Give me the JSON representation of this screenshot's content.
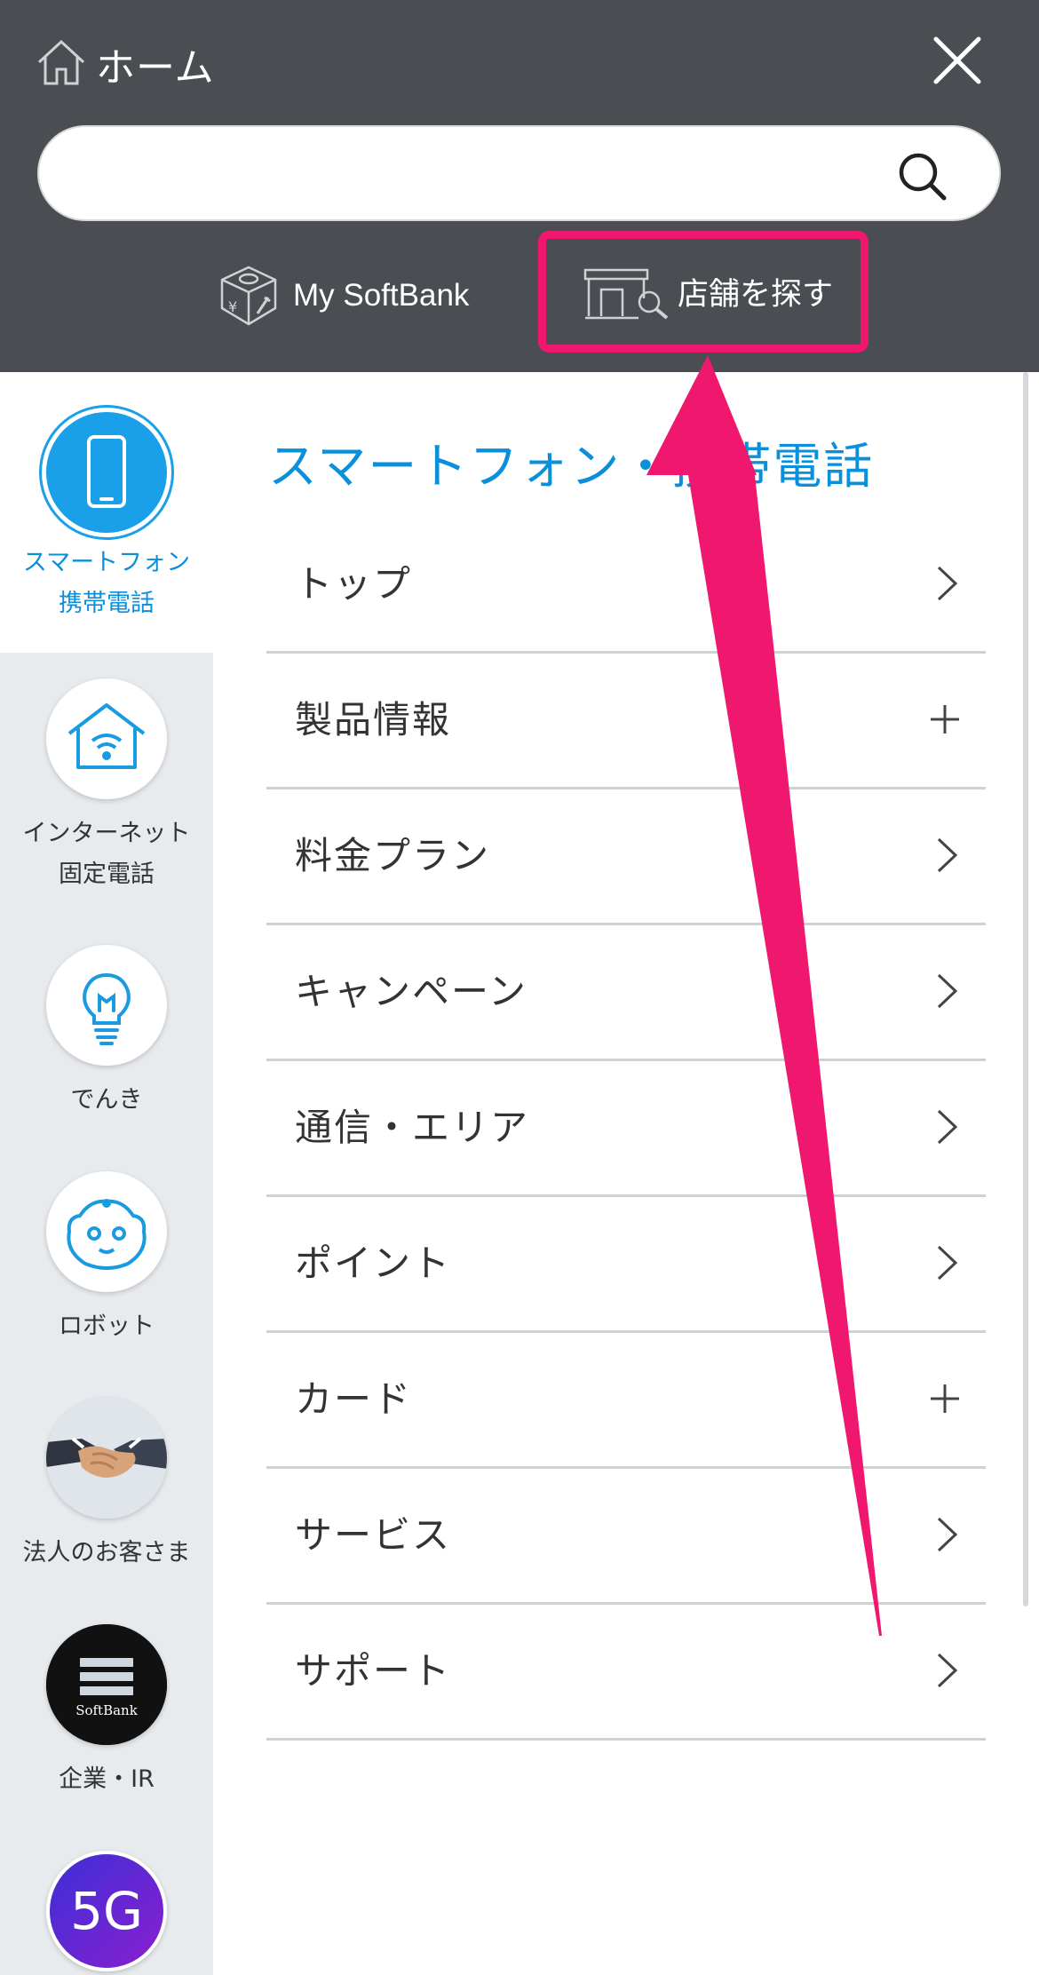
{
  "header": {
    "home_label": "ホーム",
    "search_placeholder": "",
    "mysoftbank_label": "My SoftBank",
    "store_label": "店舗を探す",
    "background": "#4a4d52"
  },
  "rail": {
    "items": [
      {
        "label_line1": "スマートフォン",
        "label_line2": "携帯電話",
        "icon": "smartphone-icon",
        "active": true
      },
      {
        "label_line1": "インターネット",
        "label_line2": "固定電話",
        "icon": "house-wifi-icon"
      },
      {
        "label_line1": "でんき",
        "label_line2": "",
        "icon": "lightbulb-icon"
      },
      {
        "label_line1": "ロボット",
        "label_line2": "",
        "icon": "robot-face-icon"
      },
      {
        "label_line1": "法人のお客さま",
        "label_line2": "",
        "icon": "handshake-icon"
      },
      {
        "label_line1": "企業・IR",
        "label_line2": "",
        "icon": "softbank-logo-icon",
        "logo_text": "SoftBank"
      },
      {
        "label_line1": "",
        "label_line2": "",
        "icon": "5g-icon",
        "logo_text": "5G"
      }
    ]
  },
  "main": {
    "title": "スマートフォン・携帯電話",
    "menu": [
      {
        "label": "トップ",
        "icon": "chevron-right-icon"
      },
      {
        "label": "製品情報",
        "icon": "plus-icon"
      },
      {
        "label": "料金プラン",
        "icon": "chevron-right-icon"
      },
      {
        "label": "キャンペーン",
        "icon": "chevron-right-icon"
      },
      {
        "label": "通信・エリア",
        "icon": "chevron-right-icon"
      },
      {
        "label": "ポイント",
        "icon": "chevron-right-icon"
      },
      {
        "label": "カード",
        "icon": "plus-icon"
      },
      {
        "label": "サービス",
        "icon": "chevron-right-icon"
      },
      {
        "label": "サポート",
        "icon": "chevron-right-icon"
      }
    ]
  },
  "colors": {
    "accent_blue": "#0a8fdb",
    "annotation_pink": "#f0186e",
    "rail_bg": "#e8ebee"
  }
}
